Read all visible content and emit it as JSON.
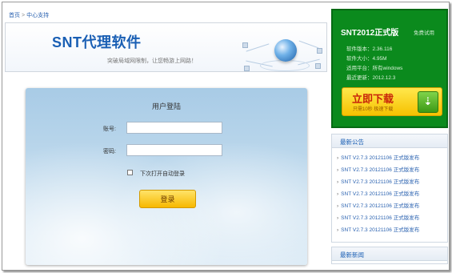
{
  "breadcrumb": {
    "home": "首页",
    "separator": ">",
    "current": "中心支持"
  },
  "banner": {
    "title": "SNT代理软件",
    "slogan": "突破局域网限制，让您畅游上网路！",
    "graphic_icon": "globe-network-icon"
  },
  "login": {
    "title": "用户登陆",
    "account_label": "账号:",
    "account_value": "",
    "password_label": "密码:",
    "password_value": "",
    "remember_label": "下次打开自动登录",
    "remember_checked": false,
    "submit_label": "登录"
  },
  "download": {
    "product": "SNT2012正式版",
    "badge": "免费试用",
    "info": [
      "软件版本：2.36.116",
      "软件大小：4.95M",
      "适用平台：所有windows",
      "最近更新：2012.12.3"
    ],
    "button_label": "立即下载",
    "button_sub": "只需10秒 极速下载",
    "button_icon": "download-arrow-icon"
  },
  "notice": {
    "title": "最新公告",
    "items": [
      "SNT V2.7.3 20121106 正式版发布",
      "SNT V2.7.3 20121106 正式版发布",
      "SNT V2.7.3 20121106 正式版发布",
      "SNT V2.7.3 20121106 正式版发布",
      "SNT V2.7.3 20121106 正式版发布",
      "SNT V2.7.3 20121106 正式版发布",
      "SNT V2.7.3 20121106 正式版发布"
    ]
  },
  "news": {
    "title": "最新新闻"
  }
}
